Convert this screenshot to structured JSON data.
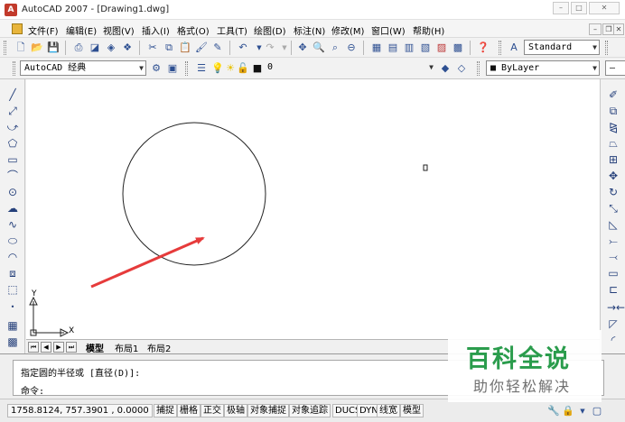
{
  "window": {
    "title": "AutoCAD 2007 - [Drawing1.dwg]",
    "controls": {
      "minimize": "–",
      "maximize": "□",
      "close": "✕"
    }
  },
  "menubar": {
    "items": [
      "文件(F)",
      "编辑(E)",
      "视图(V)",
      "插入(I)",
      "格式(O)",
      "工具(T)",
      "绘图(D)",
      "标注(N)",
      "修改(M)",
      "窗口(W)",
      "帮助(H)"
    ],
    "mdi_controls": {
      "minimize": "–",
      "restore": "❐",
      "close": "✕"
    }
  },
  "toolbar": {
    "text_style": "Standard",
    "workspace": "AutoCAD 经典",
    "layer": "0",
    "color": "ByLayer"
  },
  "drawing": {
    "ucs": {
      "y_label": "Y",
      "x_label": "X"
    }
  },
  "tabs": {
    "items": [
      "模型",
      "布局1",
      "布局2"
    ],
    "active": "模型"
  },
  "command": {
    "history": "指定圆的半径或 [直径(D)]:",
    "prompt": "命令:"
  },
  "status": {
    "coords": "1758.8124,  757.3901 , 0.0000",
    "buttons": [
      "捕捉",
      "栅格",
      "正交",
      "极轴",
      "对象捕捉",
      "对象追踪",
      "DUCS",
      "DYN",
      "线宽",
      "模型"
    ]
  },
  "watermark": {
    "title": "百科全说",
    "subtitle": "助你轻松解决"
  },
  "colors": {
    "arrow": "#e63b3b",
    "watermark_green": "#2a9c4c",
    "canvas": "#ffffff"
  }
}
